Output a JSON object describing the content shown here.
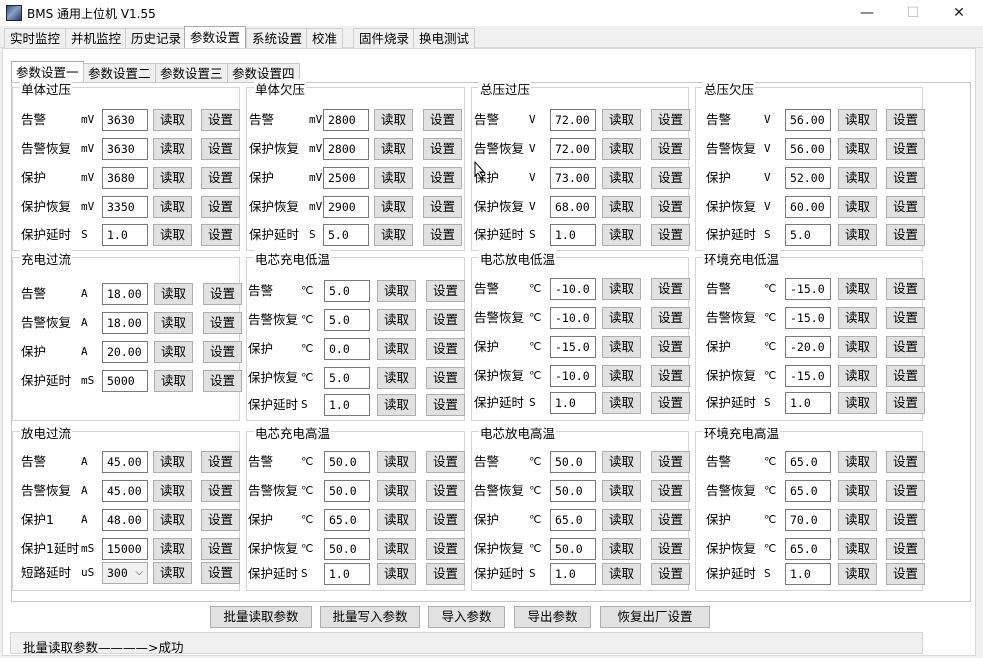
{
  "window": {
    "title": "BMS 通用上位机 V1.55",
    "minimize_glyph": "—",
    "maximize_glyph": "☐",
    "close_glyph": "✕"
  },
  "menu_tabs": [
    "实时监控",
    "并机监控",
    "历史记录",
    "参数设置",
    "系统设置",
    "校准",
    "固件烧录",
    "换电测试"
  ],
  "sub_tabs": [
    "参数设置一",
    "参数设置二",
    "参数设置三",
    "参数设置四"
  ],
  "buttons": {
    "read": "读取",
    "set": "设置"
  },
  "groups": [
    {
      "title": "单体过压",
      "rows": [
        {
          "label": "告警",
          "unit": "mV",
          "value": "3630"
        },
        {
          "label": "告警恢复",
          "unit": "mV",
          "value": "3630"
        },
        {
          "label": "保护",
          "unit": "mV",
          "value": "3680"
        },
        {
          "label": "保护恢复",
          "unit": "mV",
          "value": "3350"
        },
        {
          "label": "保护延时",
          "unit": "S",
          "value": "1.0"
        }
      ]
    },
    {
      "title": "单体欠压",
      "rows": [
        {
          "label": "告警",
          "unit": "mV",
          "value": "2800"
        },
        {
          "label": "保护恢复",
          "unit": "mV",
          "value": "2800"
        },
        {
          "label": "保护",
          "unit": "mV",
          "value": "2500"
        },
        {
          "label": "保护恢复",
          "unit": "mV",
          "value": "2900"
        },
        {
          "label": "保护延时",
          "unit": "S",
          "value": "5.0"
        }
      ]
    },
    {
      "title": "总压过压",
      "rows": [
        {
          "label": "告警",
          "unit": "V",
          "value": "72.00"
        },
        {
          "label": "告警恢复",
          "unit": "V",
          "value": "72.00"
        },
        {
          "label": "保护",
          "unit": "V",
          "value": "73.00"
        },
        {
          "label": "保护恢复",
          "unit": "V",
          "value": "68.00"
        },
        {
          "label": "保护延时",
          "unit": "S",
          "value": "1.0"
        }
      ]
    },
    {
      "title": "总压欠压",
      "rows": [
        {
          "label": "告警",
          "unit": "V",
          "value": "56.00"
        },
        {
          "label": "告警恢复",
          "unit": "V",
          "value": "56.00"
        },
        {
          "label": "保护",
          "unit": "V",
          "value": "52.00"
        },
        {
          "label": "保护恢复",
          "unit": "V",
          "value": "60.00"
        },
        {
          "label": "保护延时",
          "unit": "S",
          "value": "5.0"
        }
      ]
    },
    {
      "title": "充电过流",
      "rows": [
        {
          "label": "告警",
          "unit": "A",
          "value": "18.00"
        },
        {
          "label": "告警恢复",
          "unit": "A",
          "value": "18.00"
        },
        {
          "label": "保护",
          "unit": "A",
          "value": "20.00"
        },
        {
          "label": "保护延时",
          "unit": "mS",
          "value": "5000"
        }
      ]
    },
    {
      "title": "电芯充电低温",
      "rows": [
        {
          "label": "告警",
          "unit": "℃",
          "value": "5.0"
        },
        {
          "label": "告警恢复",
          "unit": "℃",
          "value": "5.0"
        },
        {
          "label": "保护",
          "unit": "℃",
          "value": "0.0"
        },
        {
          "label": "保护恢复",
          "unit": "℃",
          "value": "5.0"
        },
        {
          "label": "保护延时",
          "unit": "S",
          "value": "1.0"
        }
      ]
    },
    {
      "title": "电芯放电低温",
      "rows": [
        {
          "label": "告警",
          "unit": "℃",
          "value": "-10.0"
        },
        {
          "label": "告警恢复",
          "unit": "℃",
          "value": "-10.0"
        },
        {
          "label": "保护",
          "unit": "℃",
          "value": "-15.0"
        },
        {
          "label": "保护恢复",
          "unit": "℃",
          "value": "-10.0"
        },
        {
          "label": "保护延时",
          "unit": "S",
          "value": "1.0"
        }
      ]
    },
    {
      "title": "环境充电低温",
      "rows": [
        {
          "label": "告警",
          "unit": "℃",
          "value": "-15.0"
        },
        {
          "label": "告警恢复",
          "unit": "℃",
          "value": "-15.0"
        },
        {
          "label": "保护",
          "unit": "℃",
          "value": "-20.0"
        },
        {
          "label": "保护恢复",
          "unit": "℃",
          "value": "-15.0"
        },
        {
          "label": "保护延时",
          "unit": "S",
          "value": "1.0"
        }
      ]
    },
    {
      "title": "放电过流",
      "rows": [
        {
          "label": "告警",
          "unit": "A",
          "value": "45.00"
        },
        {
          "label": "告警恢复",
          "unit": "A",
          "value": "45.00"
        },
        {
          "label": "保护1",
          "unit": "A",
          "value": "48.00"
        },
        {
          "label": "保护1延时",
          "unit": "mS",
          "value": "15000"
        },
        {
          "label": "短路延时",
          "unit": "uS",
          "value": "300",
          "dropdown": true
        }
      ]
    },
    {
      "title": "电芯充电高温",
      "rows": [
        {
          "label": "告警",
          "unit": "℃",
          "value": "50.0"
        },
        {
          "label": "告警恢复",
          "unit": "℃",
          "value": "50.0"
        },
        {
          "label": "保护",
          "unit": "℃",
          "value": "65.0"
        },
        {
          "label": "保护恢复",
          "unit": "℃",
          "value": "50.0"
        },
        {
          "label": "保护延时",
          "unit": "S",
          "value": "1.0"
        }
      ]
    },
    {
      "title": "电芯放电高温",
      "rows": [
        {
          "label": "告警",
          "unit": "℃",
          "value": "50.0"
        },
        {
          "label": "告警恢复",
          "unit": "℃",
          "value": "50.0"
        },
        {
          "label": "保护",
          "unit": "℃",
          "value": "65.0"
        },
        {
          "label": "保护恢复",
          "unit": "℃",
          "value": "50.0"
        },
        {
          "label": "保护延时",
          "unit": "S",
          "value": "1.0"
        }
      ]
    },
    {
      "title": "环境充电高温",
      "rows": [
        {
          "label": "告警",
          "unit": "℃",
          "value": "65.0"
        },
        {
          "label": "告警恢复",
          "unit": "℃",
          "value": "65.0"
        },
        {
          "label": "保护",
          "unit": "℃",
          "value": "70.0"
        },
        {
          "label": "保护恢复",
          "unit": "℃",
          "value": "65.0"
        },
        {
          "label": "保护延时",
          "unit": "S",
          "value": "1.0"
        }
      ]
    }
  ],
  "bottom_buttons": [
    "批量读取参数",
    "批量写入参数",
    "导入参数",
    "导出参数",
    "恢复出厂设置"
  ],
  "status": {
    "text": "批量读取参数————>成功"
  },
  "icons": {
    "app": "app-icon",
    "cursor": "mouse-cursor-icon"
  }
}
